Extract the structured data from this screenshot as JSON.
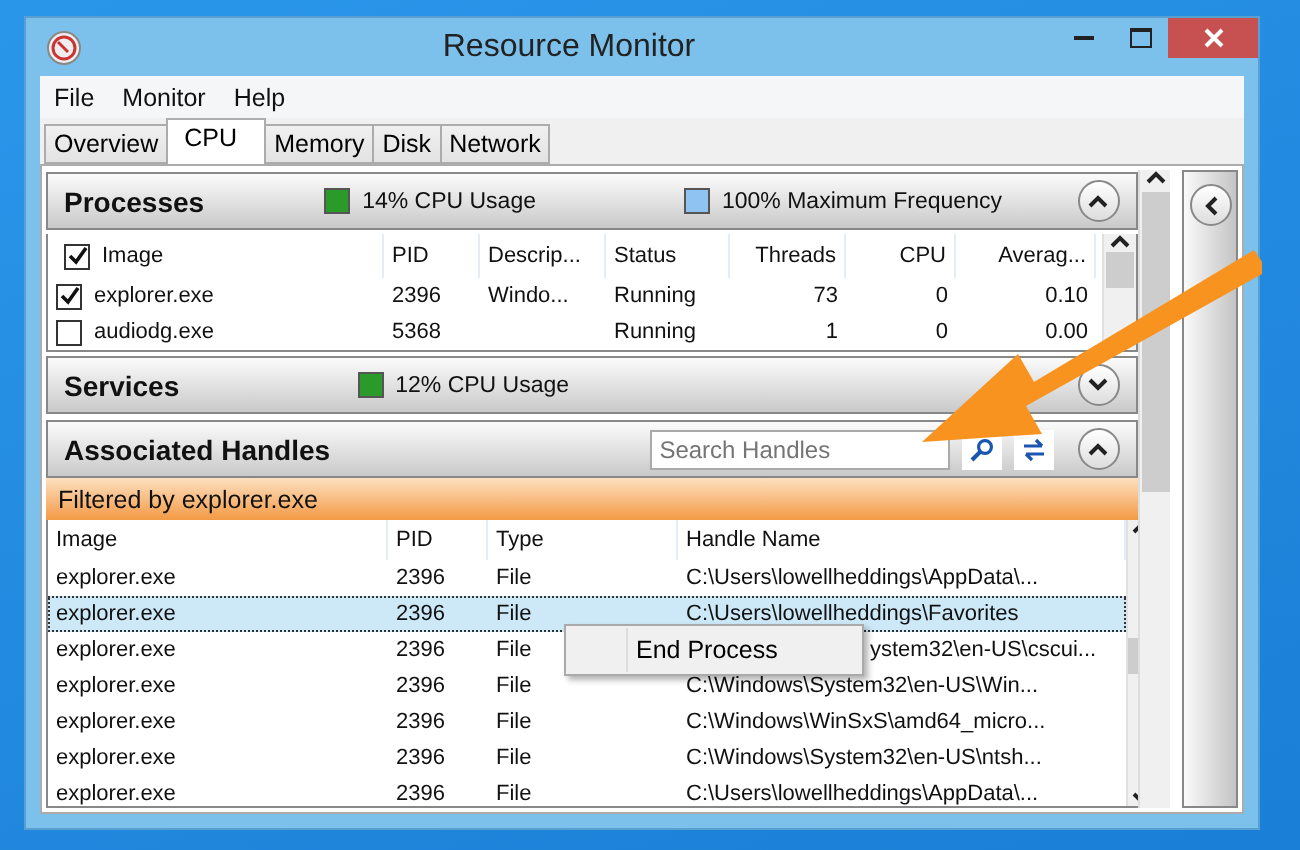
{
  "window": {
    "title": "Resource Monitor"
  },
  "menu": [
    "File",
    "Monitor",
    "Help"
  ],
  "tabs": [
    {
      "label": "Overview",
      "selected": false
    },
    {
      "label": "CPU",
      "selected": true
    },
    {
      "label": "Memory",
      "selected": false
    },
    {
      "label": "Disk",
      "selected": false
    },
    {
      "label": "Network",
      "selected": false
    }
  ],
  "processes": {
    "title": "Processes",
    "cpu_usage": "14% CPU Usage",
    "max_frequency": "100% Maximum Frequency",
    "expanded": true,
    "all_checked": true,
    "columns": [
      "Image",
      "PID",
      "Descrip...",
      "Status",
      "Threads",
      "CPU",
      "Averag..."
    ],
    "rows": [
      {
        "checked": true,
        "cells": [
          "explorer.exe",
          "2396",
          "Windo...",
          "Running",
          "73",
          "0",
          "0.10"
        ]
      },
      {
        "checked": false,
        "cells": [
          "audiodg.exe",
          "5368",
          "",
          "Running",
          "1",
          "0",
          "0.00"
        ]
      }
    ]
  },
  "services": {
    "title": "Services",
    "cpu_usage": "12% CPU Usage",
    "expanded": false
  },
  "handles": {
    "title": "Associated Handles",
    "search_placeholder": "Search Handles",
    "expanded": true,
    "filter": "Filtered by explorer.exe",
    "columns": [
      "Image",
      "PID",
      "Type",
      "Handle Name"
    ],
    "rows": [
      {
        "selected": false,
        "cells": [
          "explorer.exe",
          "2396",
          "File",
          "C:\\Users\\lowellheddings\\AppData\\..."
        ]
      },
      {
        "selected": true,
        "cells": [
          "explorer.exe",
          "2396",
          "File",
          "C:\\Users\\lowellheddings\\Favorites"
        ]
      },
      {
        "selected": false,
        "cells": [
          "explorer.exe",
          "2396",
          "File",
          "ystem32\\en-US\\cscui..."
        ]
      },
      {
        "selected": false,
        "cells": [
          "explorer.exe",
          "2396",
          "File",
          "C:\\Windows\\System32\\en-US\\Win..."
        ]
      },
      {
        "selected": false,
        "cells": [
          "explorer.exe",
          "2396",
          "File",
          "C:\\Windows\\WinSxS\\amd64_micro..."
        ]
      },
      {
        "selected": false,
        "cells": [
          "explorer.exe",
          "2396",
          "File",
          "C:\\Windows\\System32\\en-US\\ntsh..."
        ]
      },
      {
        "selected": false,
        "cells": [
          "explorer.exe",
          "2396",
          "File",
          "C:\\Users\\lowellheddings\\AppData\\..."
        ]
      }
    ]
  },
  "context_menu": [
    "End Process"
  ]
}
